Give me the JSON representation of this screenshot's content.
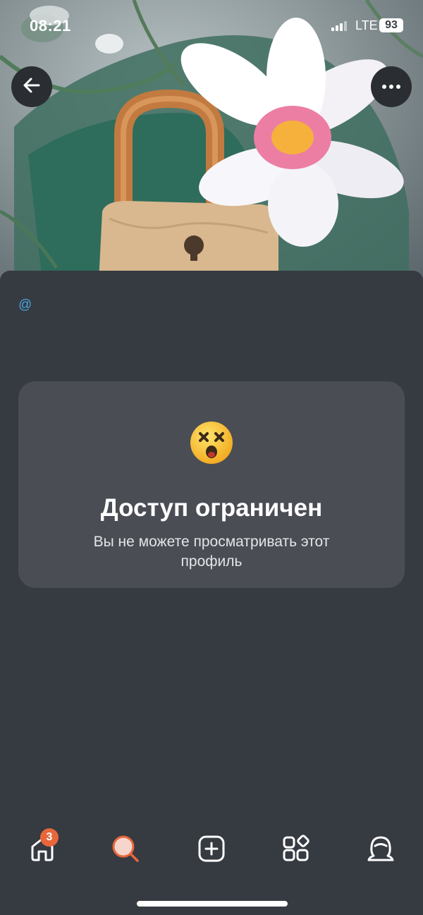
{
  "status_bar": {
    "time": "08:21",
    "network": "LTE",
    "battery": "93"
  },
  "cover": {
    "description_icon": "lock-and-lotus-image"
  },
  "header": {
    "back_icon": "arrow-left-icon",
    "more_icon": "more-dots-icon"
  },
  "profile": {
    "handle": "@"
  },
  "restricted_card": {
    "emoji": "dizzy-face-emoji",
    "title": "Доступ ограничен",
    "subtitle": "Вы не можете просматривать этот профиль"
  },
  "tabbar": {
    "home_badge": "3",
    "active_tab": "search",
    "accent_color": "#e8663a",
    "tabs": [
      "home-icon",
      "search-icon",
      "add-icon",
      "services-icon",
      "profile-icon"
    ]
  }
}
